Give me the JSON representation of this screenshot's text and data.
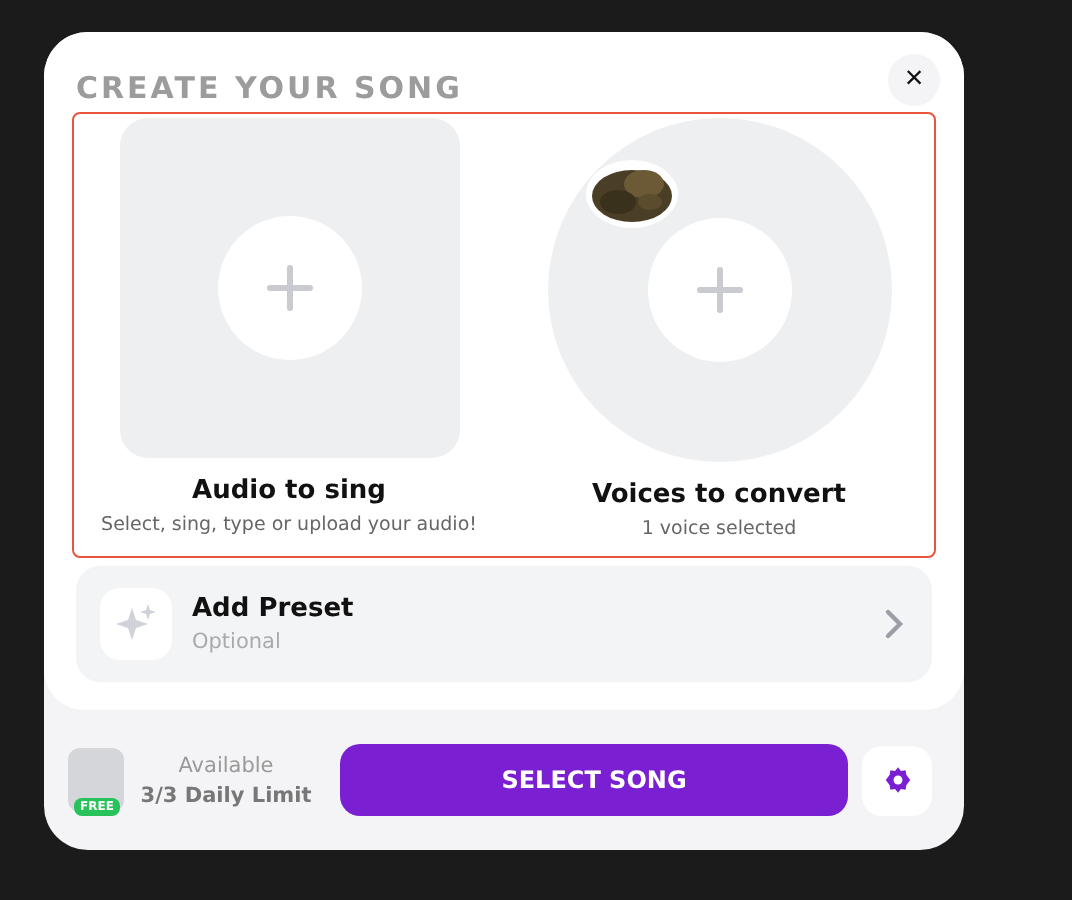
{
  "dialog": {
    "title": "CREATE YOUR SONG",
    "close": "×",
    "sources": [
      {
        "kind": "square",
        "label": "Audio to sing",
        "subtitle": "Select, sing, type or upload your audio!",
        "has_avatar": false
      },
      {
        "kind": "circle",
        "label": "Voices to convert",
        "subtitle": "1 voice selected",
        "has_avatar": true
      }
    ],
    "preset": {
      "title": "Add Preset",
      "subtitle": "Optional"
    },
    "footer": {
      "badge": "FREE",
      "available": "Available",
      "limit": "3/3 Daily Limit",
      "button": "SELECT SONG"
    }
  }
}
